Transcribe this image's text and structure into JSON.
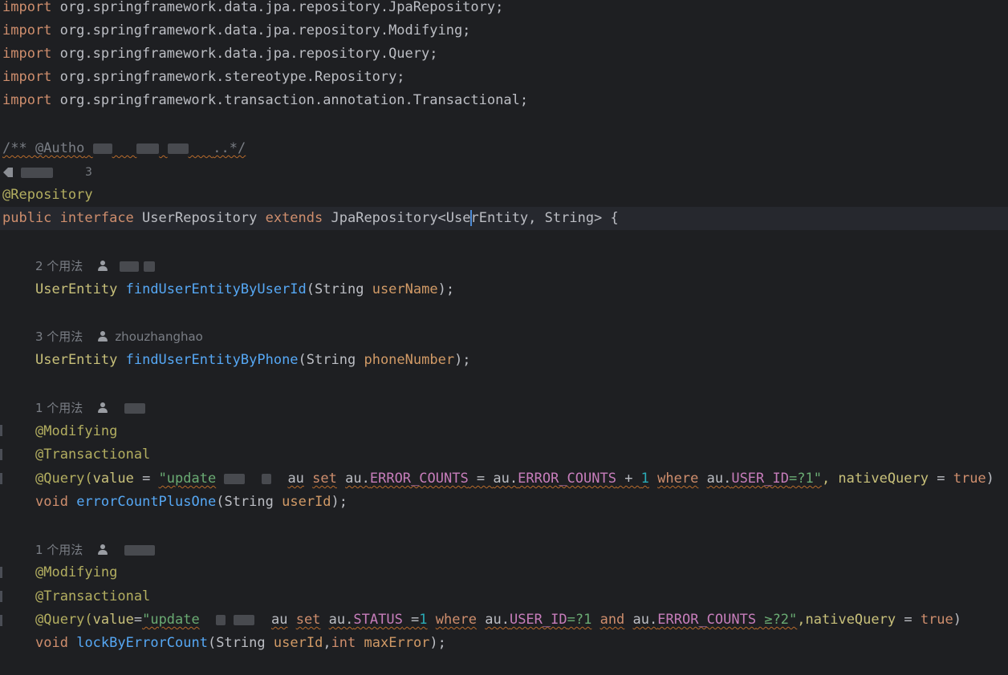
{
  "imports": [
    {
      "kw": "import",
      "path": "org.springframework.data.jpa.repository.JpaRepository;"
    },
    {
      "kw": "import",
      "path": "org.springframework.data.jpa.repository.Modifying;"
    },
    {
      "kw": "import",
      "path": "org.springframework.data.jpa.repository.Query;"
    },
    {
      "kw": "import",
      "path": "org.springframework.stereotype.Repository;"
    },
    {
      "kw": "import",
      "path": "org.springframework.transaction.annotation.Transactional;"
    }
  ],
  "doc_comment": {
    "start": "/** @Autho",
    "end": "..*/"
  },
  "blame_count": "3",
  "repository_annotation": "@Repository",
  "decl": {
    "public": "public",
    "interface": "interface",
    "name": "UserRepository",
    "extends": "extends",
    "base": "JpaRepository<",
    "entity_a": "Use",
    "entity_b": "rEntity",
    "rest": ", String> {"
  },
  "methods": [
    {
      "usage": "2 个用法",
      "author": "",
      "return_type": "UserEntity",
      "name": "findUserEntityByUserId",
      "param_type": "String",
      "param_name": "userName",
      "close": ");"
    },
    {
      "usage": "3 个用法",
      "author": "zhouzhanghao",
      "return_type": "UserEntity",
      "name": "findUserEntityByPhone",
      "param_type": "String",
      "param_name": "phoneNumber",
      "close": ");"
    },
    {
      "usage": "1 个用法",
      "author": "",
      "modifying": "@Modifying",
      "transactional": "@Transactional",
      "query_prefix": "@Query(",
      "query_value_key": "value",
      "query_eq": " = ",
      "sql_open": "\"update",
      "sql_alias": "au",
      "sql_set": "set",
      "sql_au1": "au.",
      "sql_col1": "ERROR_COUNTS",
      "sql_eq1": " = ",
      "sql_au2": "au.",
      "sql_col2": "ERROR_COUNTS",
      "sql_plus": " + ",
      "sql_num": "1",
      "sql_where": "where",
      "sql_au3": "au.",
      "sql_col3": "USER_ID",
      "sql_tail": "=?1\"",
      "native_key": ", nativeQuery",
      "native_eq": " = ",
      "native_val": "true",
      "close_paren": ")",
      "void": "void",
      "name": "errorCountPlusOne",
      "param_type": "String",
      "param_name": "userId",
      "close": ");"
    },
    {
      "usage": "1 个用法",
      "author": "",
      "modifying": "@Modifying",
      "transactional": "@Transactional",
      "query_prefix": "@Query(",
      "query_value_key": "value",
      "query_eq": "=",
      "sql_open": "\"update",
      "sql_alias": "au",
      "sql_set": "set",
      "sql_au1": "au.",
      "sql_col1": "STATUS",
      "sql_eq1": " =",
      "sql_num": "1",
      "sql_where": "where",
      "sql_au2": "au.",
      "sql_col2": "USER_ID",
      "sql_mid": "=?1",
      "sql_and": "and",
      "sql_au3": "au.",
      "sql_col3": "ERROR_COUNTS",
      "sql_tail": " ≥?2\"",
      "native_key": ",nativeQuery",
      "native_eq": " = ",
      "native_val": "true",
      "close_paren": ")",
      "void": "void",
      "name": "lockByErrorCount",
      "param_type": "String",
      "param_name": "userId",
      "comma": ",",
      "param2_type": "int",
      "param2_name": "maxError",
      "close": ");"
    }
  ]
}
